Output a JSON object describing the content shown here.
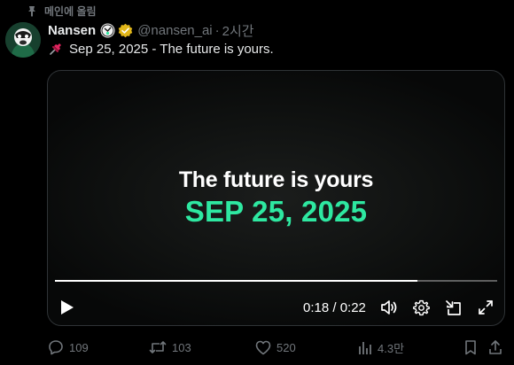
{
  "pinned": {
    "label": "메인에 올림"
  },
  "tweet": {
    "name": "Nansen",
    "handle": "@nansen_ai",
    "separator": "·",
    "time": "2시간",
    "text": "Sep 25, 2025 - The future is yours."
  },
  "video": {
    "headline": "The future is yours",
    "date": "SEP 25, 2025",
    "current_time": "0:18",
    "duration": "0:22",
    "timecode": "0:18 / 0:22",
    "progress": 0.82
  },
  "actions": {
    "replies": "109",
    "reposts": "103",
    "likes": "520",
    "views": "4.3만"
  },
  "colors": {
    "accent_green": "#2ee8a1",
    "verified_gold": "#e2b719",
    "muted": "#71767b"
  }
}
